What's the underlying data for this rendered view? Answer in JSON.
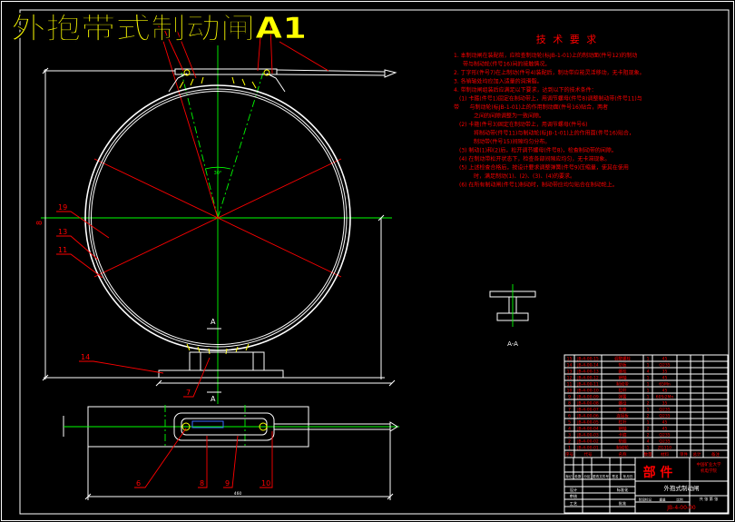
{
  "title": "外抱带式制动闸A1",
  "colors": {
    "background": "#000000",
    "line": "#ffffff",
    "centerline": "#00ff00",
    "annotation": "#ff0000",
    "title": "#ffff00",
    "accent": "#3a6cff"
  },
  "tech": {
    "heading": "技 术 要 求",
    "lines": [
      "1. 本制动闸在装配前，应检查制动轮(标JB-1-01)上的制动面(件号12)的制动",
      "带与制动轮(件号16)间的接触情况。",
      "2. 丁字形(件号7)在上制动(件号4)装配后，制动带应能灵活移动，无卡阻现象。",
      "3. 各销轴处均应加入适量的润滑脂。",
      "4. 带制动闸组装后应满足以下要求，达到以下的技术条件：",
      "(1) 卡箍(件号1)固定在制动带上，用调节螺母(件号8)调整制动带(件号11)与",
      "带      与制动轮(标JB-1-01)上的作用制动面(件号16)贴合，两者",
      "之间的间隙调整为一致间隙。",
      "(2) 卡箍(件号3)固定在制动带上，用调节螺母(件号6)",
      "将制动带(件号11)与制动轮(标JB-1-01)上的作用面(件号16)贴合，",
      "制动带(件号15)间隙均匀分布。",
      "(3) 制动(1)和(2)后，松开调节螺母(件号8)，检查制动带的间隙。",
      "(4) 在制动带松开状态下，检查各部间隙应均匀，无卡滞现象。",
      "(5) 上述检查合格后，按设计要求调整弹簧(件号9)压缩量，使其在使用",
      "时，满足制动(1)、(2)、(3)、(4)的要求。",
      "(6) 在所有制动闸(件号1)制动时，制动带应均匀贴合在制动轮上。"
    ]
  },
  "labels": {
    "front": {
      "p19": "19",
      "p13": "13",
      "p11": "11",
      "p14": "14",
      "p7": "7",
      "section_top": "A",
      "section_bottom": "A",
      "dim_left": "8",
      "angle": "30°"
    },
    "plan": {
      "p6": "6",
      "p8": "8",
      "p9": "9",
      "p10": "10",
      "dim_bottom": "460"
    },
    "section": "A-A"
  },
  "parts": {
    "header": [
      "序号",
      "代号",
      "名称",
      "数量",
      "材料",
      "单件",
      "总计",
      "备注"
    ],
    "rows": [
      [
        "15",
        "JB-4-00-15",
        "调整螺栓",
        "1",
        "45"
      ],
      [
        "14",
        "JB-4-00-14",
        "垫板",
        "1",
        "Q235"
      ],
      [
        "13",
        "JB-4-00-13",
        "螺栓",
        "4",
        "35"
      ],
      [
        "12",
        "JB-4-00-12",
        "销轴",
        "1",
        "45"
      ],
      [
        "11",
        "JB-4-00-11",
        "制动带",
        "1",
        "65Mn"
      ],
      [
        "10",
        "JB-4-00-10",
        "拉杆",
        "1",
        "45"
      ],
      [
        "9",
        "JB-4-00-09",
        "弹簧",
        "1",
        "60Si2Mn"
      ],
      [
        "8",
        "JB-4-00-08",
        "螺母",
        "2",
        "35"
      ],
      [
        "7",
        "JB-4-00-07",
        "支座",
        "1",
        "Q235"
      ],
      [
        "6",
        "JB-4-00-06",
        "连接板",
        "2",
        "Q235"
      ],
      [
        "5",
        "JB-4-00-05",
        "杠杆",
        "1",
        "45"
      ],
      [
        "4",
        "JB-4-00-04",
        "销轴",
        "2",
        "45"
      ],
      [
        "3",
        "JB-4-00-03",
        "卡箍",
        "2",
        "Q235"
      ],
      [
        "2",
        "JB-4-00-02",
        "垫圈",
        "4",
        "Q235"
      ],
      [
        "1",
        "JB-4-00-01",
        "制动轮",
        "1",
        "ZG310"
      ]
    ]
  },
  "title_block": {
    "revision_header": [
      "标记",
      "处数",
      "分区",
      "更改文件号",
      "签名",
      "年月日"
    ],
    "roles": [
      "设计",
      "审核",
      "工艺"
    ],
    "standardization": "标准化",
    "approval": "批准",
    "category": "部 件",
    "stage_header": [
      "阶段标记",
      "重量",
      "比例"
    ],
    "sheet": "共 张 第 张",
    "school": [
      "中国矿业大学",
      "机电学院"
    ],
    "drawing_name": "外抱式制动闸",
    "drawing_no": "JB-4-00-00"
  }
}
